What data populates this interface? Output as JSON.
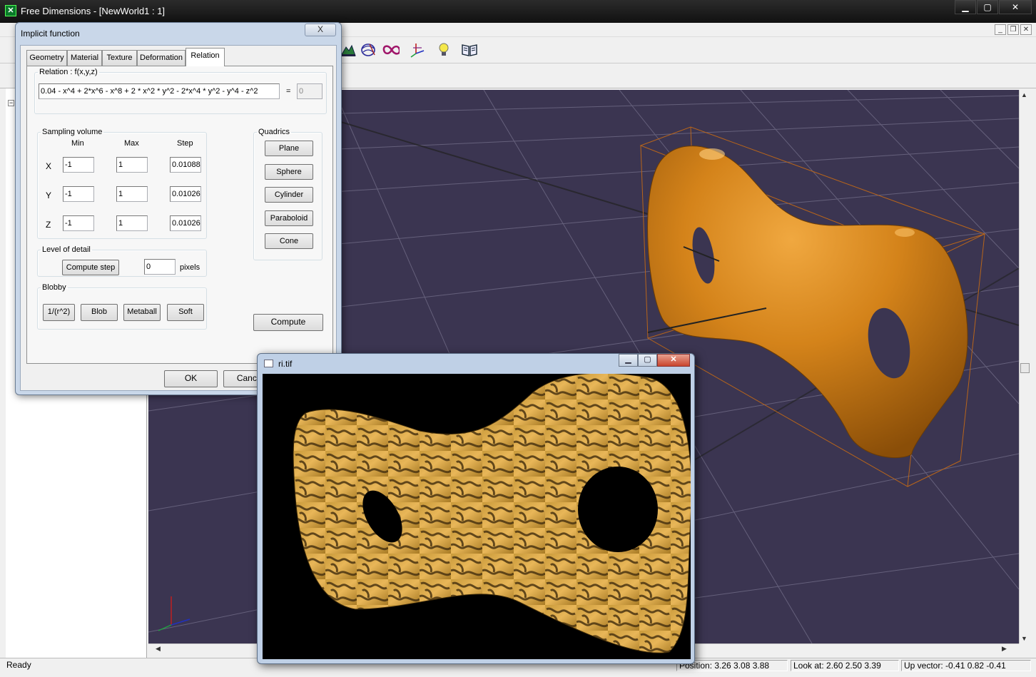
{
  "main_window": {
    "title": "Free Dimensions - [NewWorld1 : 1]",
    "caption_buttons": [
      "minimize",
      "maximize",
      "close"
    ]
  },
  "toolbar": {
    "icons": [
      "terrain-icon",
      "surface-icon",
      "torus-icon",
      "axes-icon",
      "light-bulb-icon",
      "book-icon"
    ]
  },
  "dialog": {
    "title": "Implicit function",
    "close_label": "X",
    "tabs": [
      "Geometry",
      "Material",
      "Texture",
      "Deformation",
      "Relation"
    ],
    "active_tab": "Relation",
    "relation": {
      "legend": "Relation : f(x,y,z)",
      "expression": "0.04 - x^4 + 2*x^6 - x^8 + 2 * x^2 * y^2 - 2*x^4 * y^2 - y^4 - z^2",
      "equals": "=",
      "result": "0"
    },
    "sampling": {
      "legend": "Sampling volume",
      "headers": {
        "min": "Min",
        "max": "Max",
        "step": "Step"
      },
      "rows": [
        {
          "axis": "X",
          "min": "-1",
          "max": "1",
          "step": "0.01088"
        },
        {
          "axis": "Y",
          "min": "-1",
          "max": "1",
          "step": "0.01026"
        },
        {
          "axis": "Z",
          "min": "-1",
          "max": "1",
          "step": "0.01026"
        }
      ]
    },
    "quadrics": {
      "legend": "Quadrics",
      "buttons": [
        "Plane",
        "Sphere",
        "Cylinder",
        "Paraboloid",
        "Cone"
      ]
    },
    "level_of_detail": {
      "legend": "Level of detail",
      "compute_step_label": "Compute step",
      "pixels_value": "0",
      "pixels_label": "pixels"
    },
    "blobby": {
      "legend": "Blobby",
      "buttons": [
        "1/(r^2)",
        "Blob",
        "Metaball",
        "Soft"
      ]
    },
    "compute_label": "Compute",
    "ok_label": "OK",
    "cancel_label": "Cancel"
  },
  "image_window": {
    "title": "ri.tif"
  },
  "status_bar": {
    "status": "Ready",
    "position": "Position: 3.26 3.08 3.88",
    "look_at": "Look at: 2.60 2.50 3.39",
    "up_vector": "Up vector: -0.41 0.82 -0.41"
  },
  "colors": {
    "viewport_bg": "#3b3551",
    "surface": "#c7790f",
    "grid": "#6a6580",
    "bounding_box": "#b8651a"
  }
}
